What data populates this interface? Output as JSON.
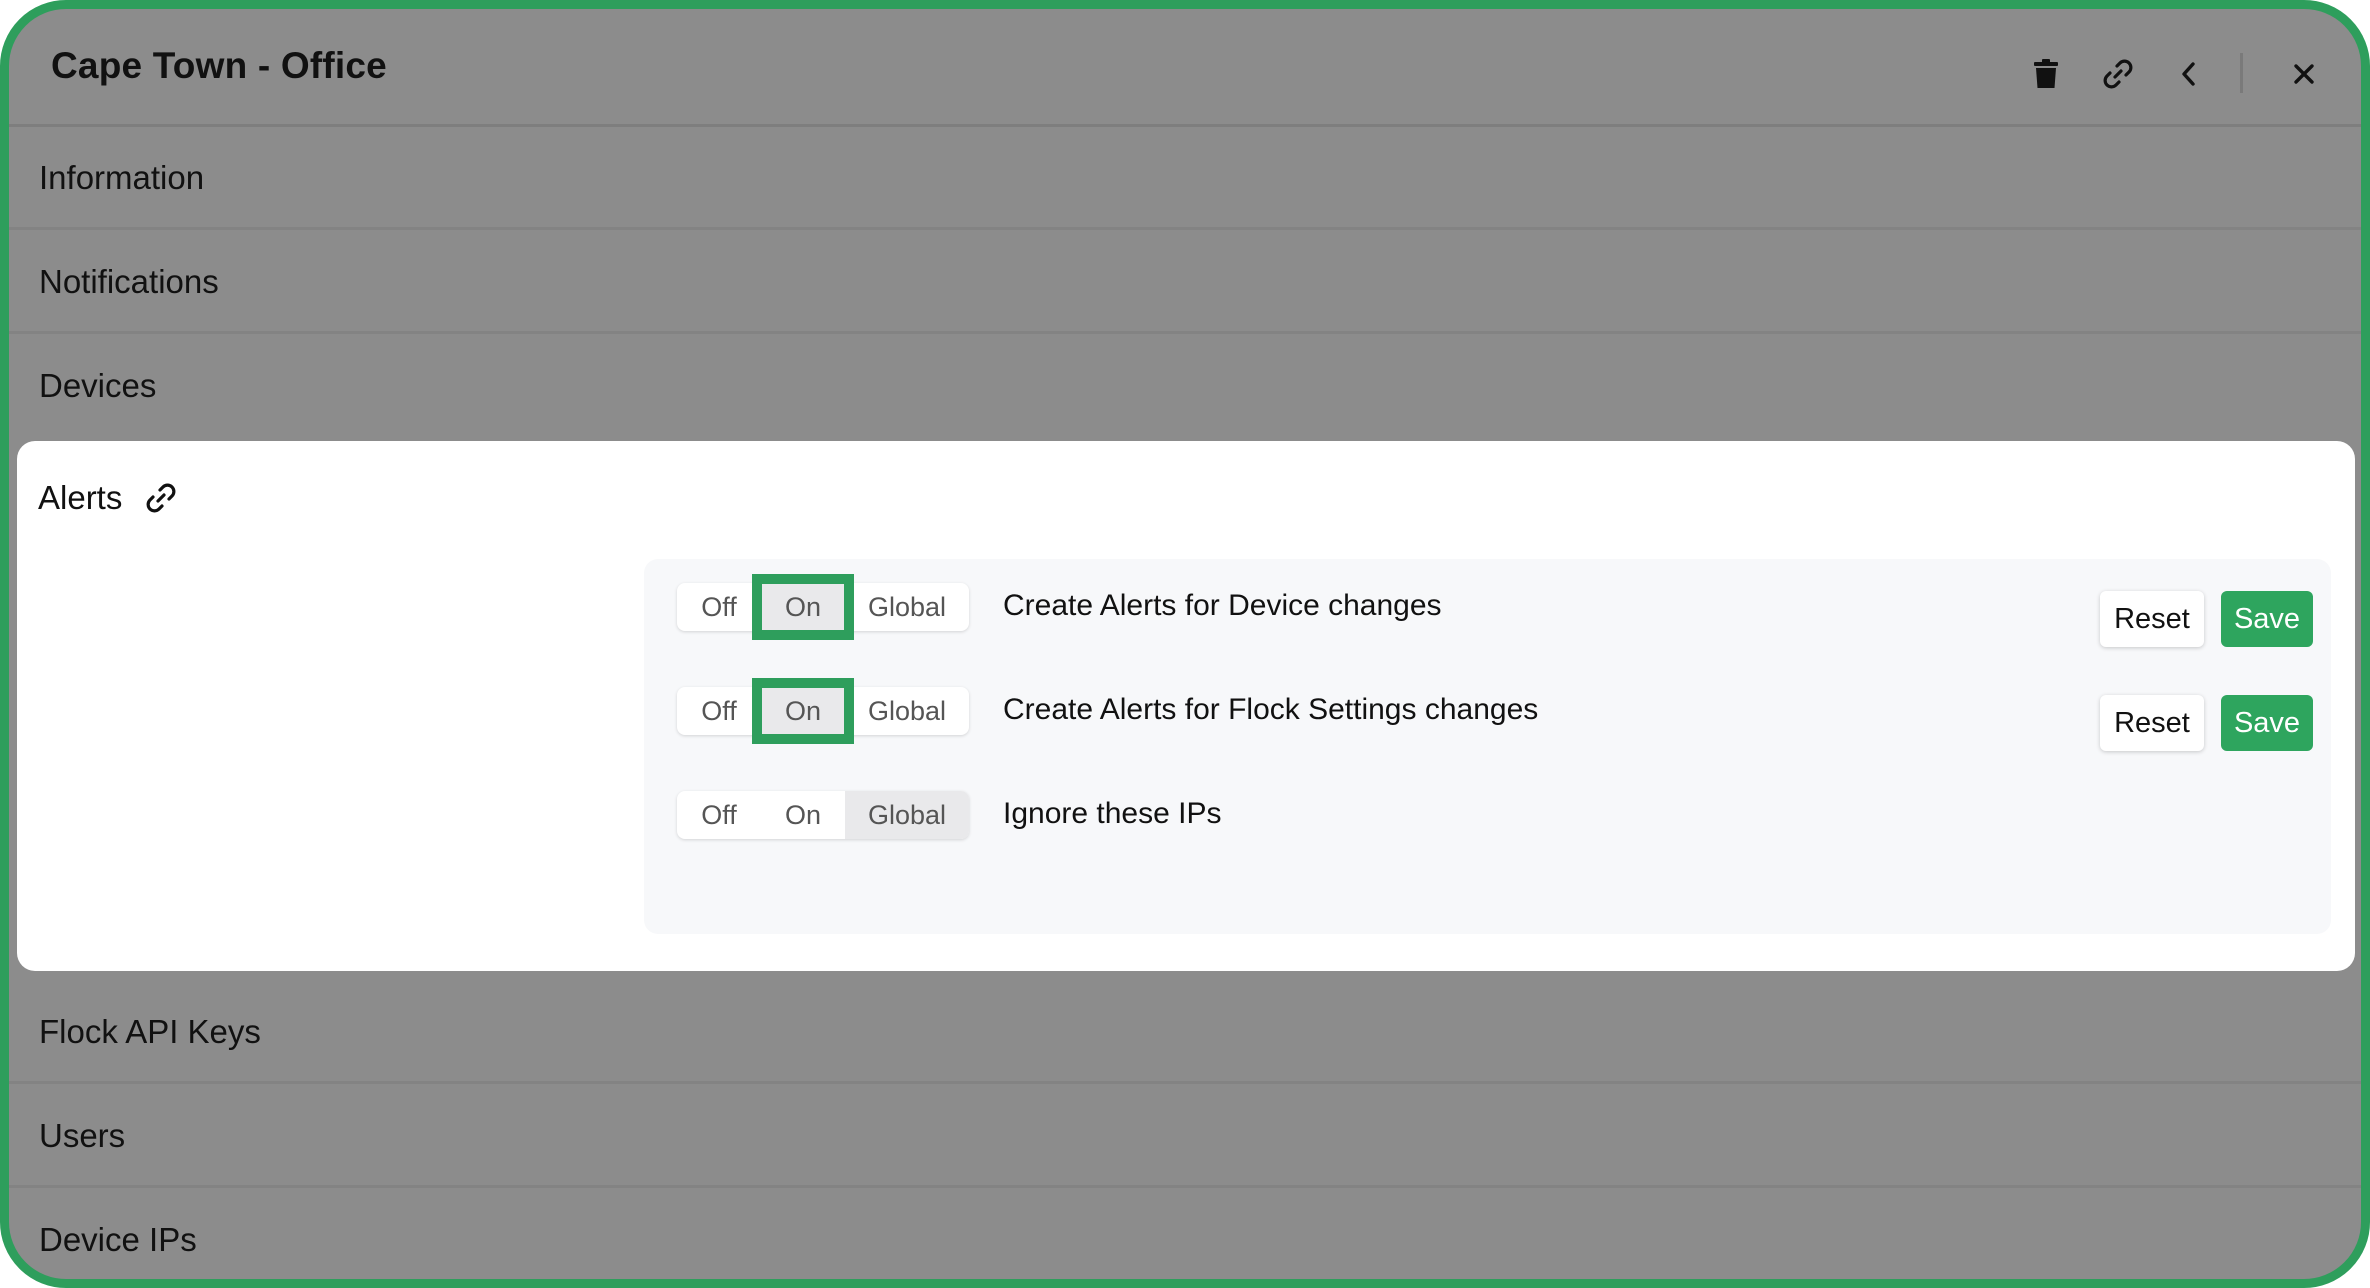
{
  "window": {
    "title": "Cape Town - Office",
    "icons": {
      "delete": "trash-icon",
      "link": "link-icon",
      "back": "chevron-left-icon",
      "close": "close-icon"
    }
  },
  "sections": {
    "information": "Information",
    "notifications": "Notifications",
    "devices": "Devices",
    "alerts": "Alerts",
    "flock_api_keys": "Flock API Keys",
    "users": "Users",
    "device_ips": "Device IPs"
  },
  "alerts": {
    "settings": [
      {
        "label": "Create Alerts for Device changes",
        "options": [
          "Off",
          "On",
          "Global"
        ],
        "selected": "On",
        "reset_label": "Reset",
        "save_label": "Save"
      },
      {
        "label": "Create Alerts for Flock Settings changes",
        "options": [
          "Off",
          "On",
          "Global"
        ],
        "selected": "On",
        "reset_label": "Reset",
        "save_label": "Save"
      },
      {
        "label": "Ignore these IPs",
        "options": [
          "Off",
          "On",
          "Global"
        ],
        "selected": "Global"
      }
    ]
  },
  "colors": {
    "accent": "#2e9e5c",
    "save_button": "#2ea55e",
    "backdrop": "#8c8c8c",
    "panel": "#f7f8fa"
  }
}
